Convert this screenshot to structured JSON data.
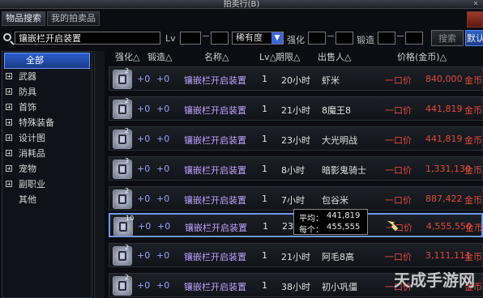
{
  "window": {
    "title": "拍卖行(B)"
  },
  "tabs": [
    {
      "label": "物品搜索"
    },
    {
      "label": "我的拍卖品"
    }
  ],
  "search": {
    "query": "镶嵌栏开启装置",
    "lv_label": "Lv",
    "rarity_label": "稀有度",
    "enhance_label": "强化",
    "forge_label": "锻造",
    "search_button": "搜索",
    "default_button": "默认"
  },
  "categories": [
    {
      "label": "全部",
      "selected": true
    },
    {
      "label": "武器"
    },
    {
      "label": "防具"
    },
    {
      "label": "首饰"
    },
    {
      "label": "特殊装备"
    },
    {
      "label": "设计图"
    },
    {
      "label": "消耗品"
    },
    {
      "label": "宠物"
    },
    {
      "label": "副职业"
    },
    {
      "label": "其他"
    }
  ],
  "table": {
    "headers": {
      "enhance": "强化△",
      "forge": "锻造△",
      "name": "名称△",
      "lv": "Lv△",
      "time": "期限△",
      "seller": "出售人△",
      "price": "价格(金币)△"
    },
    "rows": [
      {
        "enhance": "+0",
        "forge": "+0",
        "name": "镶嵌栏开启装置",
        "lv": "1",
        "time": "20小时",
        "seller": "虾米",
        "type": "一口价",
        "price": "840,000",
        "currency": "金币",
        "icon_level": "2"
      },
      {
        "enhance": "+0",
        "forge": "+0",
        "name": "镶嵌栏开启装置",
        "lv": "1",
        "time": "21小时",
        "seller": "8魔王8",
        "type": "一口价",
        "price": "441,819",
        "currency": "金币",
        "icon_level": "2"
      },
      {
        "enhance": "+0",
        "forge": "+0",
        "name": "镶嵌栏开启装置",
        "lv": "1",
        "time": "23小时",
        "seller": "大光明战",
        "type": "一口价",
        "price": "441,819",
        "currency": "金币",
        "icon_level": "2"
      },
      {
        "enhance": "+0",
        "forge": "+0",
        "name": "镶嵌栏开启装置",
        "lv": "1",
        "time": "8小时",
        "seller": "暗影鬼骑士",
        "type": "一口价",
        "price": "1,331,130",
        "currency": "金币",
        "icon_level": "3"
      },
      {
        "enhance": "+0",
        "forge": "+0",
        "name": "镶嵌栏开启装置",
        "lv": "1",
        "time": "7小时",
        "seller": "包谷米",
        "type": "一口价",
        "price": "887,422",
        "currency": "金币",
        "icon_level": "2"
      },
      {
        "enhance": "+0",
        "forge": "+0",
        "name": "镶嵌栏开启装置",
        "lv": "1",
        "time": "23",
        "seller": "",
        "type": "一口价",
        "price": "4,555,550",
        "currency": "金币",
        "icon_level": "10",
        "selected": true
      },
      {
        "enhance": "+0",
        "forge": "+0",
        "name": "镶嵌栏开启装置",
        "lv": "1",
        "time": "21小时",
        "seller": "阿毛8高",
        "type": "一口价",
        "price": "3,111,111",
        "currency": "金币",
        "icon_level": "2"
      },
      {
        "enhance": "+0",
        "forge": "+0",
        "name": "镶嵌栏开启装置",
        "lv": "1",
        "time": "38小时",
        "seller": "初小巩僵",
        "type": "一口价",
        "price": "",
        "currency": "金币",
        "icon_level": "2"
      }
    ]
  },
  "tooltip": {
    "avg_label": "平均：",
    "avg_value": "441,819",
    "each_label": "每个：",
    "each_value": "455,555"
  },
  "watermark": "天成手游网"
}
